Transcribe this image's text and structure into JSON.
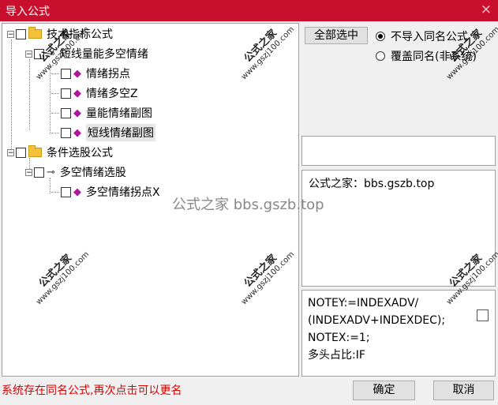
{
  "window": {
    "title": "导入公式",
    "close": "×"
  },
  "tree": {
    "group1": {
      "label": "技术指标公式"
    },
    "group1_sub": {
      "label": "短线量能多空情绪"
    },
    "items1": [
      {
        "label": "情绪拐点"
      },
      {
        "label": "情绪多空Z"
      },
      {
        "label": "量能情绪副图"
      },
      {
        "label": "短线情绪副图"
      }
    ],
    "group2": {
      "label": "条件选股公式"
    },
    "group2_sub": {
      "label": "多空情绪选股"
    },
    "items2": [
      {
        "label": "多空情绪拐点X"
      }
    ]
  },
  "controls": {
    "select_all": "全部选中",
    "radio_skip": "不导入同名公式",
    "radio_overwrite": "覆盖同名(非系统)"
  },
  "description": "公式之家：bbs.gszb.top",
  "code_lines": [
    "NOTEY:=INDEXADV/",
    "(INDEXADV+INDEXDEC);",
    "NOTEX:=1;",
    "多头占比:IF"
  ],
  "status": "系统存在同名公式,再次点击可以更名",
  "buttons": {
    "ok": "确定",
    "cancel": "取消"
  },
  "watermark": {
    "name": "公式之家",
    "url": "www.gszj100.com",
    "center": "公式之家 bbs.gszb.top"
  }
}
